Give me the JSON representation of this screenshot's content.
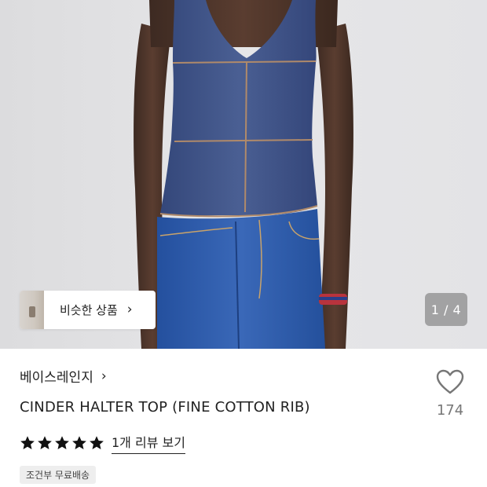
{
  "gallery": {
    "image_description_icon": "product-photo",
    "page_current": "1",
    "page_total": "4",
    "page_indicator": "1 / 4",
    "similar_label": "비슷한 상품",
    "similar_icon": "chevron-right-icon"
  },
  "product": {
    "brand": "베이스레인지",
    "brand_icon": "chevron-right-icon",
    "title": "CINDER HALTER TOP (FINE COTTON RIB)",
    "like_count": "174",
    "rating": 5,
    "review_link": "1개 리뷰 보기",
    "shipping_badge": "조건부 무료배송"
  },
  "colors": {
    "star": "#111111",
    "heart_outline": "#777777",
    "top_fabric": "#3f5586",
    "denim": "#2f5ba8"
  }
}
